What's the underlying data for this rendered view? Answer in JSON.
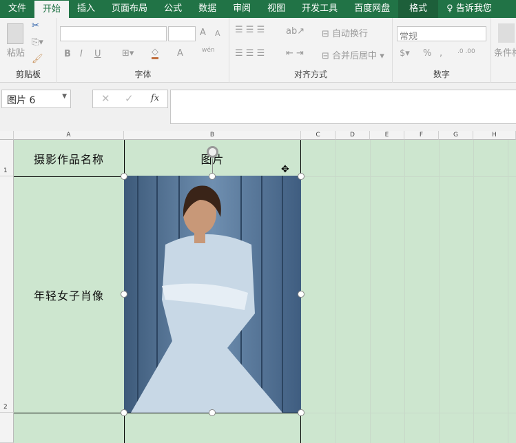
{
  "tabs": [
    "文件",
    "开始",
    "插入",
    "页面布局",
    "公式",
    "数据",
    "审阅",
    "视图",
    "开发工具",
    "百度网盘",
    "格式"
  ],
  "tell_me": "告诉我您",
  "ribbon": {
    "clipboard": {
      "label": "剪贴板",
      "paste": "粘贴"
    },
    "font": {
      "label": "字体",
      "bold": "B",
      "italic": "I",
      "underline": "U",
      "grow": "A",
      "shrink": "A",
      "font_color": "A",
      "phonetic": "wén"
    },
    "alignment": {
      "label": "对齐方式",
      "wrap": "自动换行",
      "merge": "合并后居中"
    },
    "number": {
      "label": "数字",
      "format": "常规",
      "percent": "%",
      "comma": ","
    },
    "styles": {
      "conditional": "条件格"
    }
  },
  "formula_bar": {
    "name_box": "图片 6",
    "cancel": "✕",
    "enter": "✓",
    "fx": "fx",
    "value": ""
  },
  "columns": [
    "A",
    "B",
    "C",
    "D",
    "E",
    "F",
    "G",
    "H"
  ],
  "rows": [
    "1",
    "2"
  ],
  "cells": {
    "A1": "摄影作品名称",
    "B1": "图片",
    "A2": "年轻女子肖像"
  },
  "colors": {
    "tab_green": "#217346",
    "sheet_fill": "#cde6cf"
  }
}
